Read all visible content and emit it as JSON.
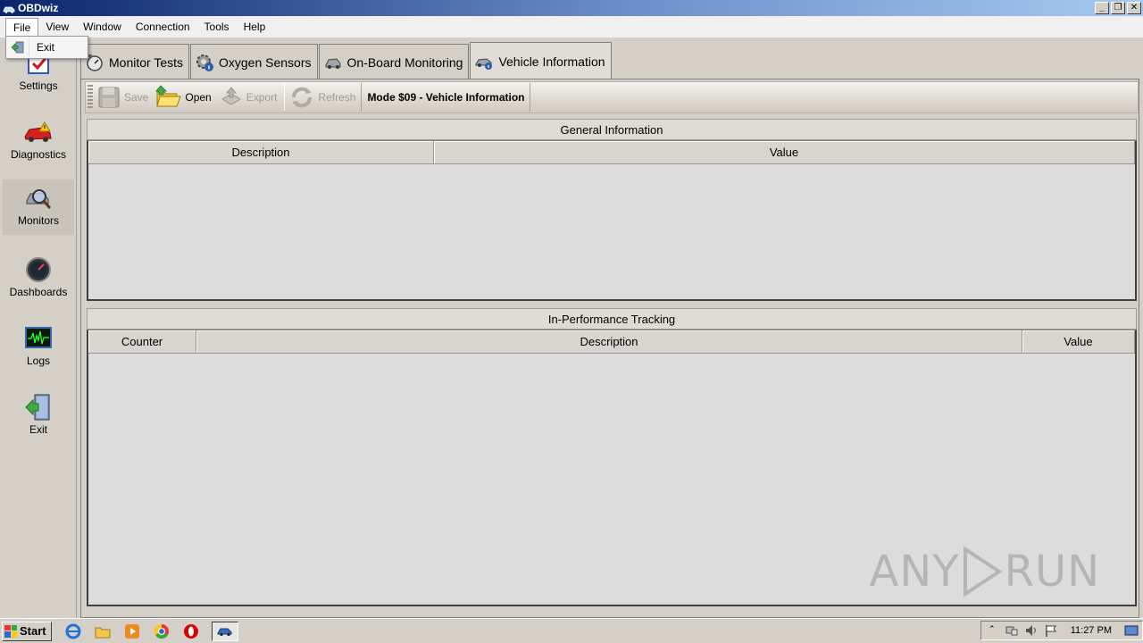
{
  "window": {
    "title": "OBDwiz"
  },
  "menu": {
    "items": [
      "File",
      "View",
      "Window",
      "Connection",
      "Tools",
      "Help"
    ],
    "file_dropdown": {
      "items": [
        "Exit"
      ]
    }
  },
  "nav": {
    "items": [
      {
        "label": "Settings",
        "icon": "checkbox-settings-icon"
      },
      {
        "label": "Diagnostics",
        "icon": "car-warning-icon"
      },
      {
        "label": "Monitors",
        "icon": "magnifier-car-icon"
      },
      {
        "label": "Dashboards",
        "icon": "gauge-icon"
      },
      {
        "label": "Logs",
        "icon": "waveform-icon"
      },
      {
        "label": "Exit",
        "icon": "exit-door-icon"
      }
    ],
    "selected": "Monitors"
  },
  "tabs": [
    {
      "label": "Monitor Tests",
      "icon": "clock-gauge-icon"
    },
    {
      "label": "Oxygen Sensors",
      "icon": "gear-info-icon"
    },
    {
      "label": "On-Board Monitoring",
      "icon": "engine-icon"
    },
    {
      "label": "Vehicle Information",
      "icon": "car-info-icon"
    }
  ],
  "active_tab": "Vehicle Information",
  "toolbar": {
    "save": "Save",
    "open": "Open",
    "export": "Export",
    "refresh": "Refresh",
    "mode": "Mode $09 - Vehicle Information"
  },
  "general_info": {
    "title": "General Information",
    "columns": [
      "Description",
      "Value"
    ],
    "rows": []
  },
  "tracking": {
    "title": "In-Performance Tracking",
    "columns": [
      "Counter",
      "Description",
      "Value"
    ],
    "rows": []
  },
  "watermark": {
    "text_left": "ANY",
    "text_right": "RUN"
  },
  "taskbar": {
    "start": "Start",
    "clock": "11:27 PM"
  },
  "colors": {
    "titlebar_start": "#0a246a",
    "titlebar_end": "#a6caf0",
    "window_bg": "#d4d0c8"
  }
}
